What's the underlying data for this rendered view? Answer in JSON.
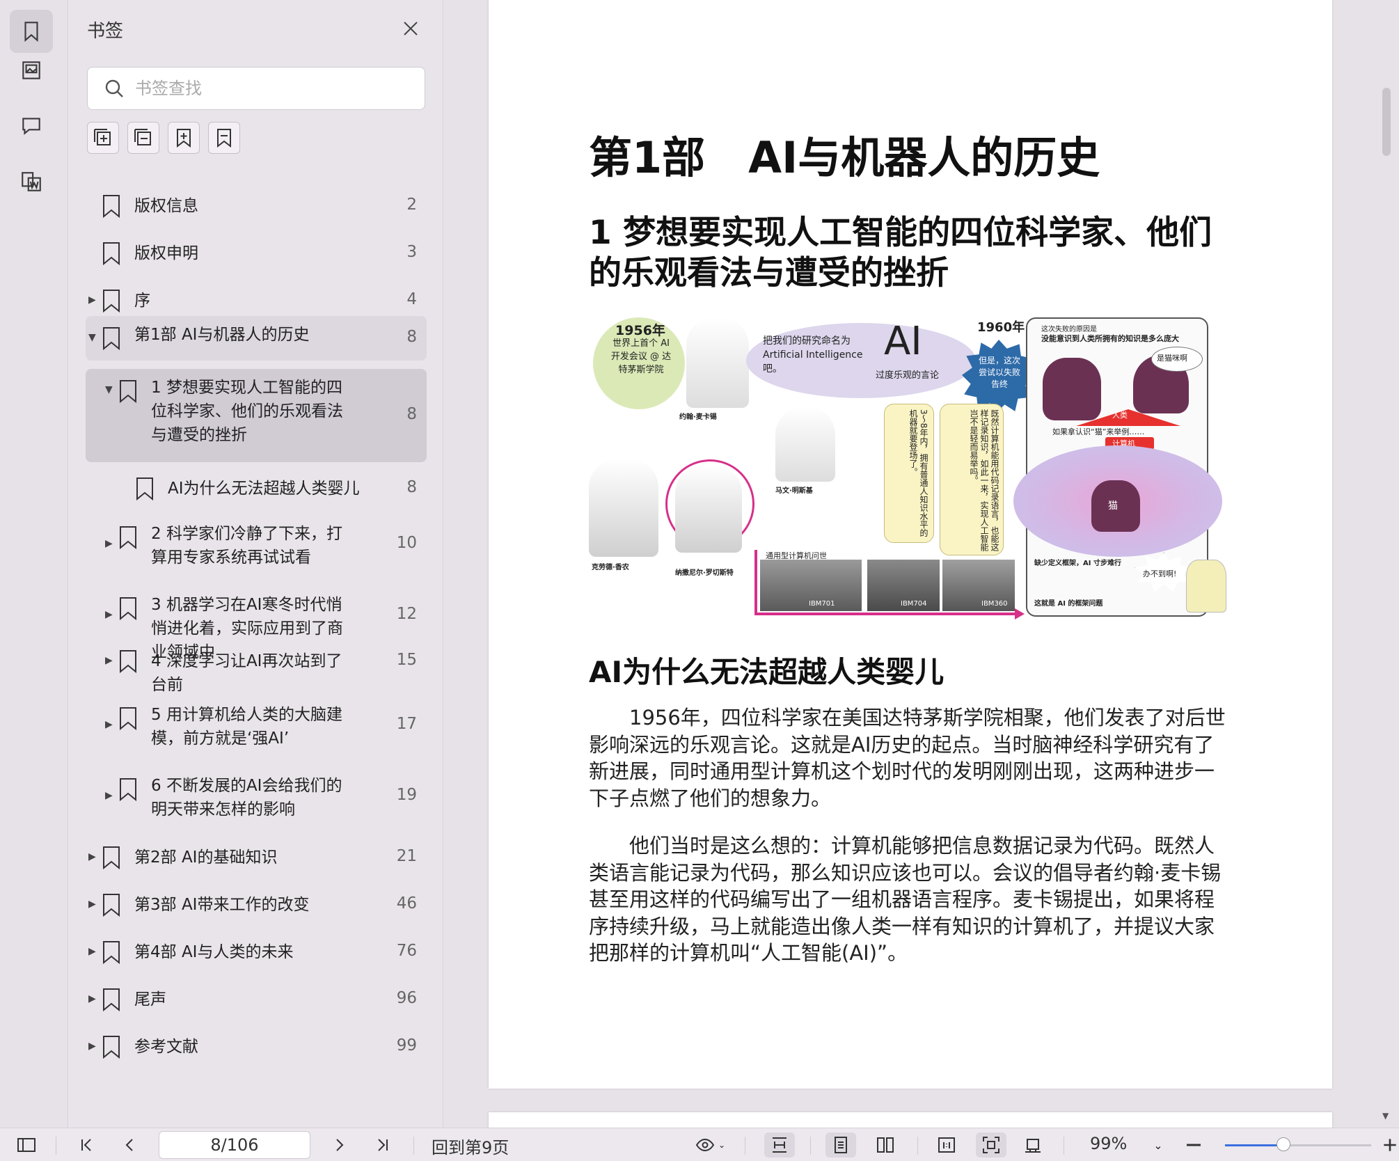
{
  "panel": {
    "title": "书签",
    "search_placeholder": "书签查找"
  },
  "bookmarks": [
    {
      "label": "版权信息",
      "page": "2",
      "level": 0,
      "expander": "none"
    },
    {
      "label": "版权申明",
      "page": "3",
      "level": 0,
      "expander": "none"
    },
    {
      "label": "序",
      "page": "4",
      "level": 0,
      "expander": "collapsed"
    },
    {
      "label": "第1部 AI与机器人的历史",
      "page": "8",
      "level": 0,
      "expander": "expanded"
    },
    {
      "label": "1 梦想要实现人工智能的四位科学家、他们的乐观看法与遭受的挫折",
      "page": "8",
      "level": 1,
      "expander": "expanded"
    },
    {
      "label": "AI为什么无法超越人类婴儿",
      "page": "8",
      "level": 2,
      "expander": "none"
    },
    {
      "label": "2 科学家们冷静了下来，打算用专家系统再试试看",
      "page": "10",
      "level": 1,
      "expander": "collapsed"
    },
    {
      "label": "3 机器学习在AI寒冬时代悄悄进化着，实际应用到了商业领域中",
      "page": "12",
      "level": 1,
      "expander": "collapsed"
    },
    {
      "label": "4 深度学习让AI再次站到了台前",
      "page": "15",
      "level": 1,
      "expander": "collapsed"
    },
    {
      "label": "5 用计算机给人类的大脑建模，前方就是‘强AI’",
      "page": "17",
      "level": 1,
      "expander": "collapsed"
    },
    {
      "label": "6 不断发展的AI会给我们的明天带来怎样的影响",
      "page": "19",
      "level": 1,
      "expander": "collapsed"
    },
    {
      "label": "第2部 AI的基础知识",
      "page": "21",
      "level": 0,
      "expander": "collapsed"
    },
    {
      "label": "第3部 AI带来工作的改变",
      "page": "46",
      "level": 0,
      "expander": "collapsed"
    },
    {
      "label": "第4部 AI与人类的未来",
      "page": "76",
      "level": 0,
      "expander": "collapsed"
    },
    {
      "label": "尾声",
      "page": "96",
      "level": 0,
      "expander": "collapsed"
    },
    {
      "label": "参考文献",
      "page": "99",
      "level": 0,
      "expander": "collapsed"
    }
  ],
  "doc": {
    "part_title": "第1部　AI与机器人的历史",
    "chapter_title": "1 梦想要实现人工智能的四位科学家、他们的乐观看法与遭受的挫折",
    "section_title": "AI为什么无法超越人类婴儿",
    "para1": "1956年，四位科学家在美国达特茅斯学院相聚，他们发表了对后世影响深远的乐观言论。这就是AI历史的起点。当时脑神经科学研究有了新进展，同时通用型计算机这个划时代的发明刚刚出现，这两种进步一下子点燃了他们的想象力。",
    "para2": "他们当时是这么想的：计算机能够把信息数据记录为代码。既然人类语言能记录为代码，那么知识应该也可以。会议的倡导者约翰·麦卡锡甚至用这样的代码编写出了一组机器语言程序。麦卡锡提出，如果将程序持续升级，马上就能造出像人类一样有知识的计算机了，并提议大家把那样的计算机叫“人工智能(AI)”。",
    "illustration": {
      "year1956": "1956年",
      "conf": "世界上首个 AI 开发会议 @ 达特茅斯学院",
      "naming": "把我们的研究命名为 Artificial Intelligence 吧。",
      "ai": "AI",
      "optimistic": "过度乐观的言论",
      "year1960": "1960年",
      "failed": "但是，这次尝试以失败告终",
      "reason_title": "这次失败的原因是",
      "reason": "没能意识到人类所拥有的知识是多么庞大",
      "cat_q": "是猫咪啊",
      "human": "人类",
      "computer": "计算机",
      "example": "如果拿认识“猫”来举例……",
      "cat": "猫",
      "impossible": "办不到啊!",
      "mccarthy": "约翰·麦卡锡",
      "minsky": "马文·明斯基",
      "shannon": "克劳德·香农",
      "rochester": "纳撒尼尔·罗切斯特",
      "quote1": "3～8年内，拥有普通人知识水平的机器就要登场了。",
      "quote2": "既然计算机能用代码记录语言，也能这样记录知识，如此一来，实现人工智能岂不是轻而易举吗。",
      "general_computer": "通用型计算机问世",
      "ibm701": "IBM701",
      "ibm704": "IBM704",
      "ibm360": "IBM360",
      "lack": "缺少定义框架，AI 寸步难行",
      "frame_problem": "这就是 AI 的框架问题"
    }
  },
  "toolbar": {
    "page_indicator": "8/106",
    "goto_label": "回到第9页",
    "zoom_label": "99%",
    "zoom_fraction": 0.4
  }
}
